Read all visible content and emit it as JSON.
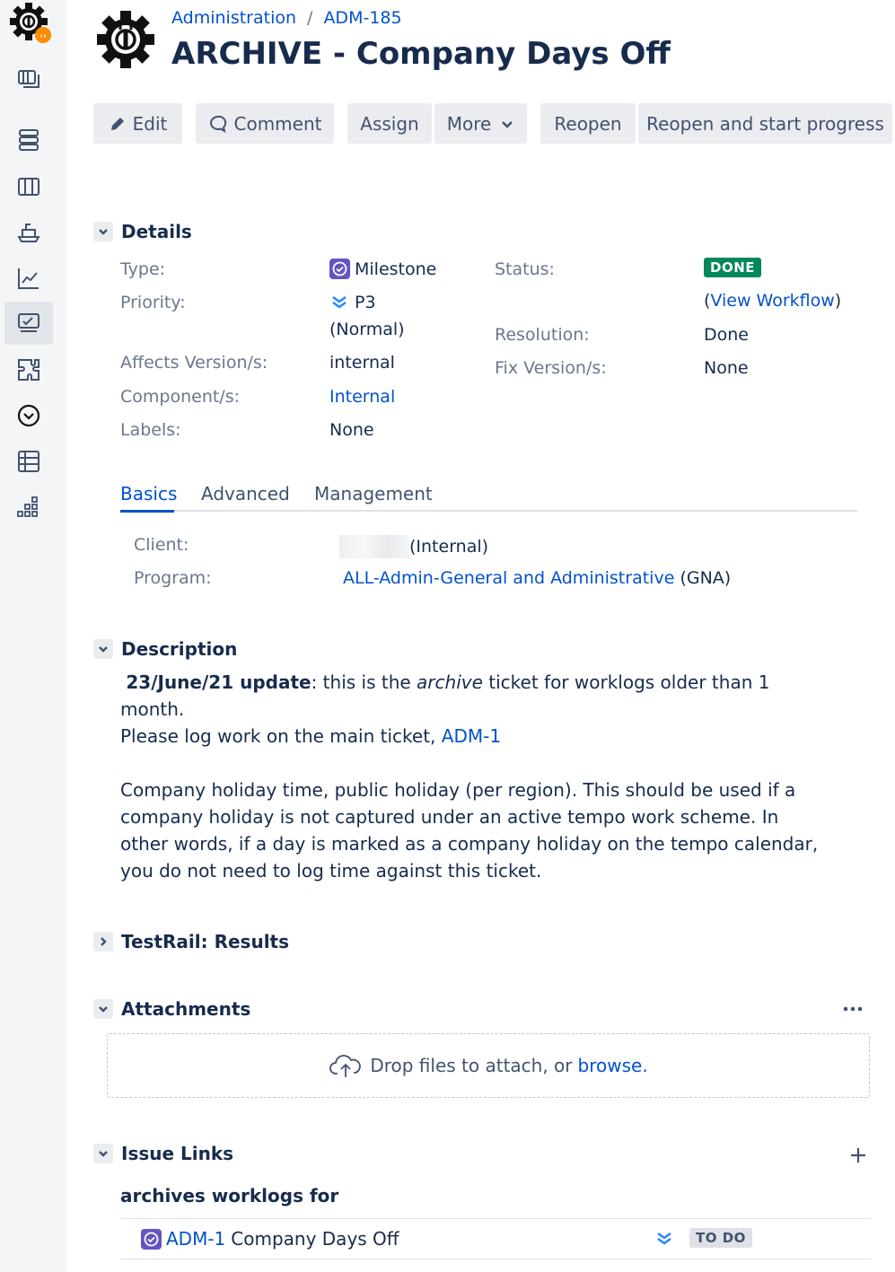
{
  "breadcrumbs": {
    "project": "Administration",
    "separator": "/",
    "issue_key": "ADM-185"
  },
  "issue": {
    "title": "ARCHIVE - Company Days Off"
  },
  "toolbar": {
    "edit": "Edit",
    "comment": "Comment",
    "assign": "Assign",
    "more": "More",
    "reopen": "Reopen",
    "reopen_start": "Reopen and start progress"
  },
  "details": {
    "heading": "Details",
    "type_label": "Type:",
    "type_value": "Milestone",
    "priority_label": "Priority:",
    "priority_value": "P3",
    "priority_sub": "(Normal)",
    "affects_label": "Affects Version/s:",
    "affects_value": "internal",
    "component_label": "Component/s:",
    "component_value": "Internal",
    "labels_label": "Labels:",
    "labels_value": "None",
    "status_label": "Status:",
    "status_value": "DONE",
    "view_workflow_open": "(",
    "view_workflow": "View Workflow",
    "view_workflow_close": ")",
    "resolution_label": "Resolution:",
    "resolution_value": "Done",
    "fix_label": "Fix Version/s:",
    "fix_value": "None"
  },
  "tabs": [
    {
      "label": "Basics",
      "active": true
    },
    {
      "label": "Advanced",
      "active": false
    },
    {
      "label": "Management",
      "active": false
    }
  ],
  "basics": {
    "client_label": "Client:",
    "client_value": "(Internal)",
    "program_label": "Program:",
    "program_link": "ALL-Admin-General and Administrative",
    "program_suffix": "(GNA)"
  },
  "description": {
    "heading": "Description",
    "update_bold": "23/June/21 update",
    "update_text1": ": this is the ",
    "update_italic": "archive",
    "update_text2": " ticket for worklogs older than 1 month.",
    "line2_text": "Please log work on the main ticket, ",
    "line2_link": "ADM-1",
    "paragraph": "Company holiday time, public holiday (per region). This should be used if a company holiday is not captured under an active tempo work scheme. In other words, if a day is marked as a company holiday on the tempo calendar, you do not need to log time against this ticket."
  },
  "testrail": {
    "heading": "TestRail: Results"
  },
  "attachments": {
    "heading": "Attachments",
    "drop_text": "Drop files to attach, or ",
    "browse": "browse."
  },
  "issue_links": {
    "heading": "Issue Links",
    "group": "archives worklogs for",
    "item_key": "ADM-1",
    "item_summary": "Company Days Off",
    "item_status": "TO DO"
  },
  "colors": {
    "done_bg": "#00875a",
    "todo_bg": "#dfe1e6",
    "milestone_purple": "#6554c0",
    "priority_blue": "#2684ff",
    "link_blue": "#0052cc"
  },
  "icons": [
    "project-gear-icon",
    "backlog-icon",
    "board-icon",
    "releases-icon",
    "reports-icon",
    "testrail-icon",
    "addons-icon",
    "tempo-icon",
    "table-icon",
    "apps-icon",
    "pencil-icon",
    "comment-icon",
    "chevron-down-icon",
    "milestone-icon",
    "priority-low-icon",
    "upload-cloud-icon",
    "more-icon",
    "plus-icon"
  ]
}
